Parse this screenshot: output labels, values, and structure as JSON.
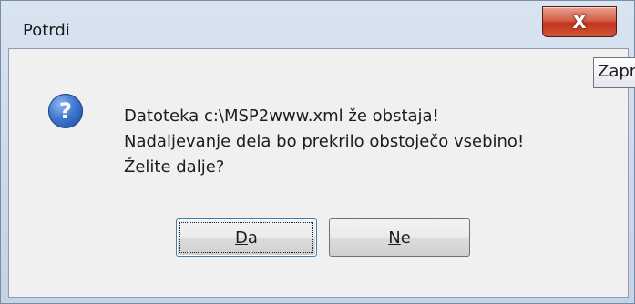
{
  "window": {
    "title": "Potrdi"
  },
  "titlebar": {
    "close_glyph": "X",
    "tooltip": "Zapri"
  },
  "dialog": {
    "icon": "question-icon",
    "icon_glyph": "?",
    "message_lines": [
      "Datoteka c:\\MSP2www.xml že obstaja!",
      "Nadaljevanje dela bo prekrilo obstoječo vsebino!",
      "Želite dalje?"
    ],
    "buttons": {
      "yes": {
        "accel": "D",
        "rest": "a"
      },
      "no": {
        "accel": "N",
        "rest": "e"
      }
    }
  },
  "colors": {
    "close_button": "#c2331c",
    "icon_blue": "#3f78d0",
    "client_bg": "#f0f0f0"
  }
}
